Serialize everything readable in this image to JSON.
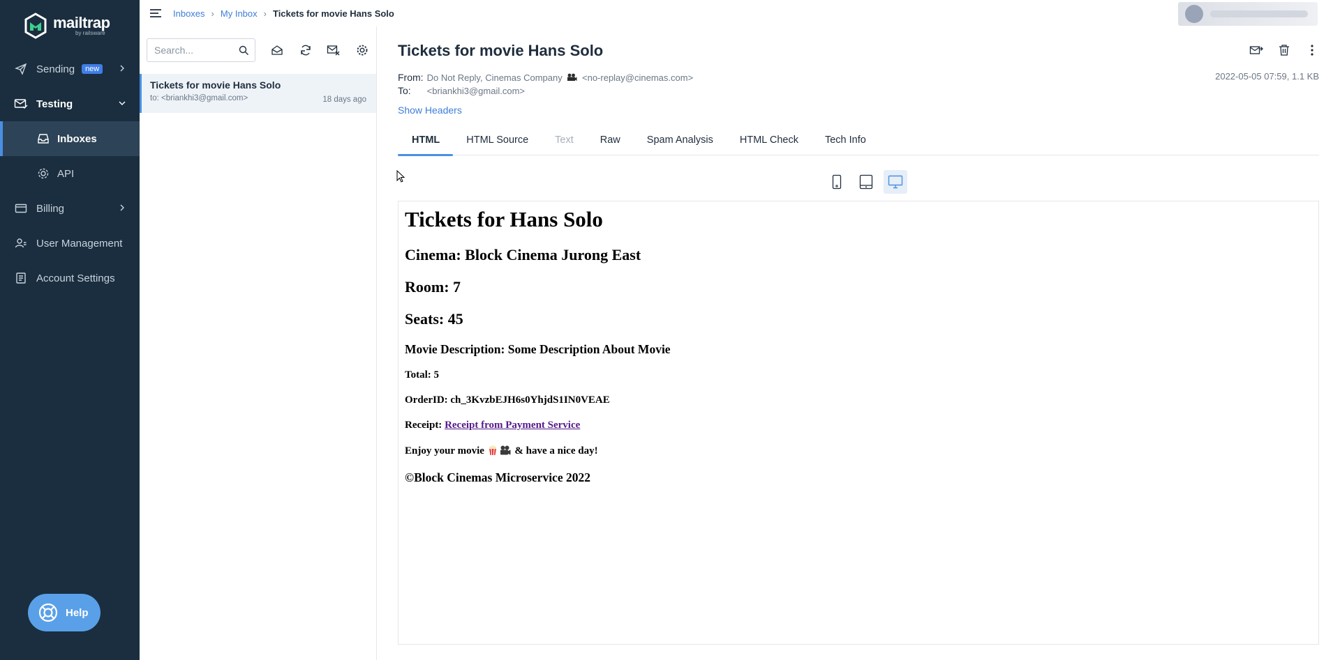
{
  "brand": {
    "name": "mailtrap",
    "sub": "by railsware"
  },
  "sidebar": {
    "items": [
      {
        "label": "Sending",
        "badge": "new"
      },
      {
        "label": "Testing"
      },
      {
        "label": "Inboxes"
      },
      {
        "label": "API"
      },
      {
        "label": "Billing"
      },
      {
        "label": "User Management"
      },
      {
        "label": "Account Settings"
      }
    ],
    "help_label": "Help"
  },
  "breadcrumb": {
    "items": [
      "Inboxes",
      "My Inbox"
    ],
    "current": "Tickets for movie Hans Solo",
    "separator": "›"
  },
  "search": {
    "placeholder": "Search..."
  },
  "messages": [
    {
      "subject": "Tickets for movie Hans Solo",
      "to": "to: <briankhi3@gmail.com>",
      "time": "18 days ago"
    }
  ],
  "email": {
    "subject": "Tickets for movie Hans Solo",
    "from_label": "From:",
    "from_name": "Do Not Reply, Cinemas Company",
    "from_address": "<no-replay@cinemas.com>",
    "to_label": "To:",
    "to_address": "<briankhi3@gmail.com>",
    "date_size": "2022-05-05 07:59, 1.1 KB",
    "show_headers": "Show Headers"
  },
  "tabs": [
    {
      "label": "HTML",
      "state": "active"
    },
    {
      "label": "HTML Source",
      "state": "normal"
    },
    {
      "label": "Text",
      "state": "disabled"
    },
    {
      "label": "Raw",
      "state": "normal"
    },
    {
      "label": "Spam Analysis",
      "state": "normal"
    },
    {
      "label": "HTML Check",
      "state": "normal"
    },
    {
      "label": "Tech Info",
      "state": "normal"
    }
  ],
  "preview": {
    "title": "Tickets for Hans Solo",
    "cinema": "Cinema: Block Cinema Jurong East",
    "room": "Room: 7",
    "seats": "Seats: 45",
    "description": "Movie Description: Some Description About Movie",
    "total": "Total: 5",
    "order": "OrderID: ch_3KvzbEJH6s0YhjdS1IN0VEAE",
    "receipt_label": "Receipt: ",
    "receipt_link": "Receipt from Payment Service",
    "enjoy_before": "Enjoy your movie ",
    "enjoy_after": " & have a nice day!",
    "footer": "©Block Cinemas Microservice 2022"
  },
  "colors": {
    "sidebar_bg": "#1a2e3f",
    "accent": "#4a90e2",
    "link": "#3d7ed9",
    "visited_link": "#551a8b"
  }
}
